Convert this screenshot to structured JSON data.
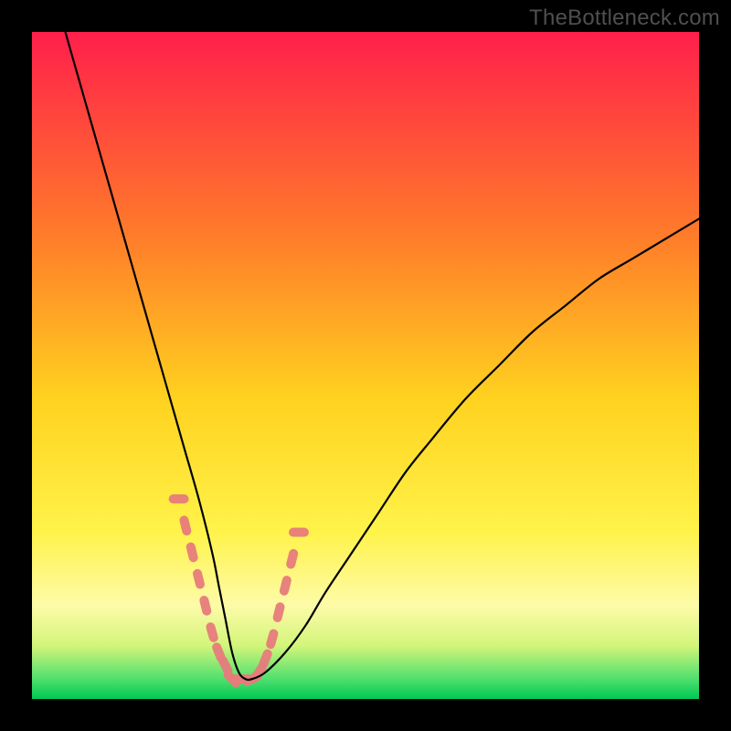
{
  "watermark": "TheBottleneck.com",
  "chart_data": {
    "type": "line",
    "title": "",
    "xlabel": "",
    "ylabel": "",
    "xlim": [
      0,
      100
    ],
    "ylim": [
      0,
      100
    ],
    "grid": false,
    "legend": false,
    "series": [
      {
        "name": "bottleneck-curve",
        "x": [
          5,
          7,
          9,
          11,
          13,
          15,
          17,
          19,
          21,
          23,
          25,
          27,
          28,
          29,
          30,
          31,
          32,
          33,
          35,
          38,
          41,
          44,
          48,
          52,
          56,
          60,
          65,
          70,
          75,
          80,
          85,
          90,
          95,
          100
        ],
        "y": [
          100,
          93,
          86,
          79,
          72,
          65,
          58,
          51,
          44,
          37,
          30,
          22,
          17,
          12,
          7,
          4,
          3,
          3,
          4,
          7,
          11,
          16,
          22,
          28,
          34,
          39,
          45,
          50,
          55,
          59,
          63,
          66,
          69,
          72
        ]
      }
    ],
    "highlight_region": {
      "name": "optimal-band-markers",
      "x": [
        22,
        23,
        24,
        25,
        26,
        27,
        28,
        29,
        30,
        31,
        32,
        33,
        34,
        35,
        36,
        37,
        38,
        39,
        40
      ],
      "y": [
        30,
        26,
        22,
        18,
        14,
        10,
        7,
        5,
        3,
        3,
        3,
        3,
        4,
        6,
        9,
        13,
        17,
        21,
        25
      ]
    },
    "gradient_bands": [
      {
        "offset": 0.0,
        "color": "#ff1f4b"
      },
      {
        "offset": 0.3,
        "color": "#ff7a2a"
      },
      {
        "offset": 0.55,
        "color": "#ffd21f"
      },
      {
        "offset": 0.75,
        "color": "#fff34a"
      },
      {
        "offset": 0.86,
        "color": "#fdfba8"
      },
      {
        "offset": 0.92,
        "color": "#d3f57a"
      },
      {
        "offset": 0.97,
        "color": "#4fe06e"
      },
      {
        "offset": 1.0,
        "color": "#00c853"
      }
    ]
  }
}
